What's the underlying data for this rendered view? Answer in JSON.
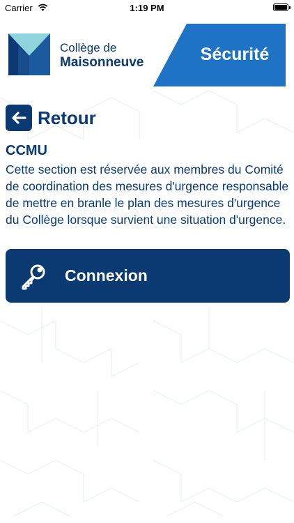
{
  "status_bar": {
    "carrier": "Carrier",
    "time": "1:19 PM"
  },
  "header": {
    "logo_line1": "Collège de",
    "logo_line2": "Maisonneuve",
    "banner_title": "Sécurité"
  },
  "nav": {
    "back_label": "Retour"
  },
  "section": {
    "title": "CCMU",
    "description": "Cette section est réservée aux membres du Comité de coordination des mesures d'urgence responsable de mettre en branle le plan des mesures d'urgence du Collège lorsque survient une situation d'urgence."
  },
  "login_button": {
    "label": "Connexion"
  },
  "colors": {
    "primary": "#0b3a73",
    "banner_blue": "#1f73c4",
    "logo_light": "#8fd3dc",
    "logo_dark": "#0b3a73",
    "logo_mid": "#1b5a9e"
  },
  "icons": {
    "back": "arrow-left-icon",
    "login": "key-icon",
    "wifi": "wifi-icon",
    "battery": "battery-icon"
  }
}
